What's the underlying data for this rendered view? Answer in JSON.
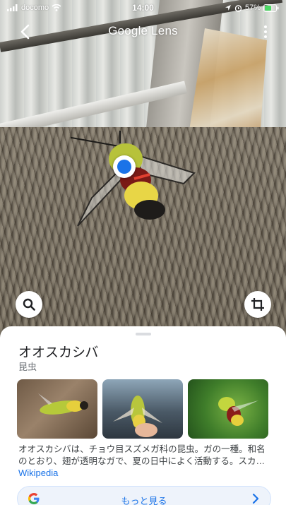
{
  "status_bar": {
    "carrier": "docomo",
    "time": "14:00",
    "battery": "57%"
  },
  "header": {
    "title": "Google Lens"
  },
  "result": {
    "name": "オオスカシバ",
    "type": "昆虫",
    "description": "オオスカシバは、チョウ目スズメガ科の昆虫。ガの一種。和名のとおり、翅が透明なガで、夏の日中によく活動する。スカ…",
    "source_link": "Wikipedia",
    "more_button": "もっと見る"
  },
  "icons": {
    "back": "chevron-left-icon",
    "more": "more-vert-icon",
    "search": "search-icon",
    "crop": "crop-icon",
    "google": "google-g-icon",
    "chevron": "chevron-right-icon"
  },
  "colors": {
    "accent": "#1a73e8",
    "sheet_bg": "#ffffff",
    "pill_bg": "#eef3fb"
  }
}
